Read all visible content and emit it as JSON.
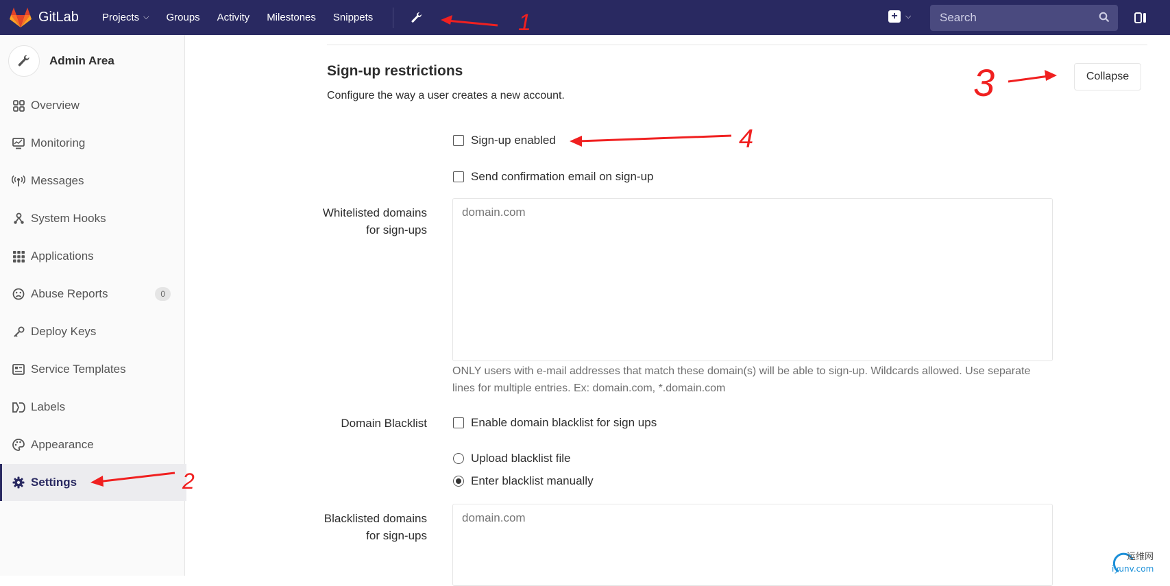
{
  "nav": {
    "brand": "GitLab",
    "links": [
      {
        "label": "Projects",
        "has_dropdown": true
      },
      {
        "label": "Groups"
      },
      {
        "label": "Activity"
      },
      {
        "label": "Milestones"
      },
      {
        "label": "Snippets"
      }
    ],
    "search_placeholder": "Search"
  },
  "sidebar": {
    "title": "Admin Area",
    "items": [
      {
        "label": "Overview",
        "icon": "overview-grid-icon"
      },
      {
        "label": "Monitoring",
        "icon": "monitor-icon"
      },
      {
        "label": "Messages",
        "icon": "broadcast-icon"
      },
      {
        "label": "System Hooks",
        "icon": "hook-icon"
      },
      {
        "label": "Applications",
        "icon": "apps-grid-icon"
      },
      {
        "label": "Abuse Reports",
        "icon": "frown-icon",
        "badge": "0"
      },
      {
        "label": "Deploy Keys",
        "icon": "key-icon"
      },
      {
        "label": "Service Templates",
        "icon": "template-icon"
      },
      {
        "label": "Labels",
        "icon": "labels-icon"
      },
      {
        "label": "Appearance",
        "icon": "palette-icon"
      },
      {
        "label": "Settings",
        "icon": "gear-icon",
        "active": true
      }
    ]
  },
  "section": {
    "title": "Sign-up restrictions",
    "description": "Configure the way a user creates a new account.",
    "collapse_label": "Collapse",
    "signup_enabled_label": "Sign-up enabled",
    "confirm_email_label": "Send confirmation email on sign-up",
    "whitelist_label": "Whitelisted domains for sign-ups",
    "whitelist_placeholder": "domain.com",
    "whitelist_help": "ONLY users with e-mail addresses that match these domain(s) will be able to sign-up. Wildcards allowed. Use separate lines for multiple entries. Ex: domain.com, *.domain.com",
    "blacklist_label": "Domain Blacklist",
    "blacklist_enable_label": "Enable domain blacklist for sign ups",
    "upload_blacklist_label": "Upload blacklist file",
    "manual_blacklist_label": "Enter blacklist manually",
    "blacklisted_label": "Blacklisted domains for sign-ups",
    "blacklisted_placeholder": "domain.com"
  },
  "annotations": [
    "1",
    "2",
    "3",
    "4"
  ],
  "watermark": {
    "text": "运维网",
    "sub": "iyunv.com"
  },
  "colors": {
    "nav_bg": "#292961",
    "search_bg": "#4a4a7f",
    "annotation": "#f02020"
  }
}
